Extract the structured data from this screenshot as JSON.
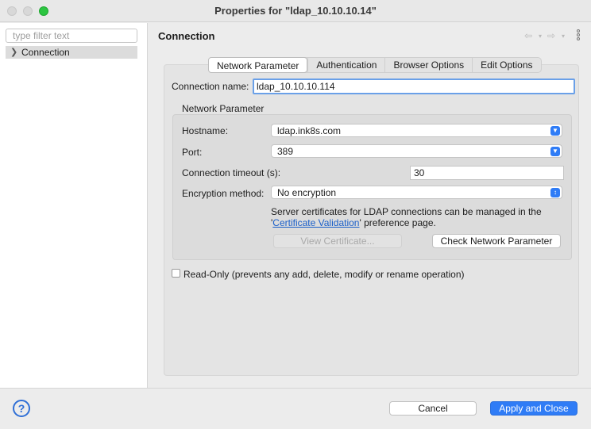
{
  "window": {
    "title": "Properties for \"ldap_10.10.10.14\""
  },
  "sidebar": {
    "filter_placeholder": "type filter text",
    "items": [
      {
        "label": "Connection",
        "expanded": false
      }
    ]
  },
  "header": {
    "title": "Connection",
    "back_icon": "back-arrow-icon",
    "forward_icon": "forward-arrow-icon",
    "menu_icon": "vertical-dots-icon"
  },
  "tabs": [
    {
      "label": "Network Parameter",
      "active": true
    },
    {
      "label": "Authentication",
      "active": false
    },
    {
      "label": "Browser Options",
      "active": false
    },
    {
      "label": "Edit Options",
      "active": false
    }
  ],
  "connection": {
    "name_label": "Connection name:",
    "name_value": "ldap_10.10.10.114"
  },
  "network": {
    "group_title": "Network Parameter",
    "hostname_label": "Hostname:",
    "hostname_value": "ldap.ink8s.com",
    "port_label": "Port:",
    "port_value": "389",
    "timeout_label": "Connection timeout (s):",
    "timeout_value": "30",
    "encryption_label": "Encryption method:",
    "encryption_value": "No encryption",
    "cert_text_line1": "Server certificates for LDAP connections can be managed in the",
    "cert_text_pre": "'",
    "cert_link": "Certificate Validation",
    "cert_text_post": "' preference page.",
    "view_cert_button": "View Certificate...",
    "check_button": "Check Network Parameter"
  },
  "readonly": {
    "label": "Read-Only (prevents any add, delete, modify or rename operation)",
    "checked": false
  },
  "footer": {
    "help_label": "?",
    "cancel_button": "Cancel",
    "apply_button": "Apply and Close"
  },
  "colors": {
    "accent": "#2f7cf6",
    "link": "#1a5fc9",
    "maximize": "#2cc541"
  }
}
